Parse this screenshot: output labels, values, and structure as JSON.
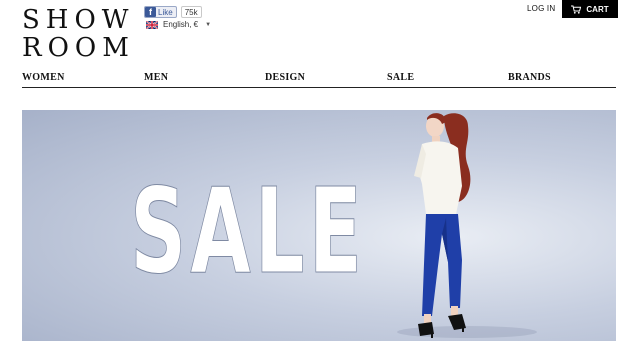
{
  "brand": {
    "line1": "SHOW",
    "line2": "ROOM"
  },
  "social": {
    "like_label": "Like",
    "like_count": "75k",
    "fb_icon": "f"
  },
  "locale": {
    "label": "English, €",
    "flag_icon": "uk-flag-icon"
  },
  "account": {
    "login_label": "LOG IN",
    "cart_label": "CART",
    "cart_icon": "cart-icon"
  },
  "nav": {
    "items": [
      {
        "label": "WOMEN"
      },
      {
        "label": "MEN"
      },
      {
        "label": "DESIGN"
      },
      {
        "label": "SALE"
      },
      {
        "label": "BRANDS"
      }
    ]
  },
  "hero": {
    "headline": "SALE"
  },
  "colors": {
    "cart_bg": "#000000",
    "fb_blue": "#3b5998",
    "pants_blue": "#1f3fa8",
    "hair": "#8a2d1f"
  }
}
